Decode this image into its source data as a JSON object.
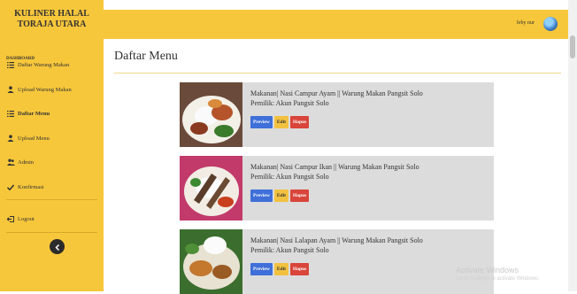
{
  "brand": {
    "line1": "KULINER HALAL",
    "line2": "TORAJA UTARA"
  },
  "sidebar": {
    "section": "DASHBOARD",
    "items": [
      {
        "label": "Daftar Warung Makan",
        "icon": "list-icon"
      },
      {
        "label": "Upload Warung Makan",
        "icon": "upload-icon"
      },
      {
        "label": "Daftar Menu",
        "icon": "list-icon",
        "active": true
      },
      {
        "label": "Upload Menu",
        "icon": "upload-icon"
      },
      {
        "label": "Admin",
        "icon": "users-icon"
      },
      {
        "label": "Konfirmasi",
        "icon": "check-icon"
      },
      {
        "label": "Logout",
        "icon": "logout-icon"
      }
    ]
  },
  "topbar": {
    "username": "feby nur"
  },
  "main": {
    "title": "Daftar Menu"
  },
  "cards": [
    {
      "line1": "Makanan| Nasi Campur Ayam || Warung Makan Pangsit Solo",
      "line2": "Pemilik: Akun Pangsit Solo",
      "preview": "Preview",
      "edit": "Edit",
      "hapus": "Hapus"
    },
    {
      "line1": "Makanan| Nasi Campur Ikan || Warung Makan Pangsit Solo",
      "line2": "Pemilik: Akun Pangsit Solo",
      "preview": "Preview",
      "edit": "Edit",
      "hapus": "Hapus"
    },
    {
      "line1": "Makanan| Nasi Lalapan Ayam || Warung Makan Pangsit Solo",
      "line2": "Pemilik: Akun Pangsit Solo",
      "preview": "Preview",
      "edit": "Edit",
      "hapus": "Hapus"
    }
  ],
  "watermark": {
    "title": "Activate Windows",
    "subtitle": "Go to Settings to activate Windows."
  },
  "colors": {
    "sidebar": "#f7c73b",
    "preview": "#3f6fd8",
    "edit": "#f2c140",
    "hapus": "#d9453a"
  }
}
